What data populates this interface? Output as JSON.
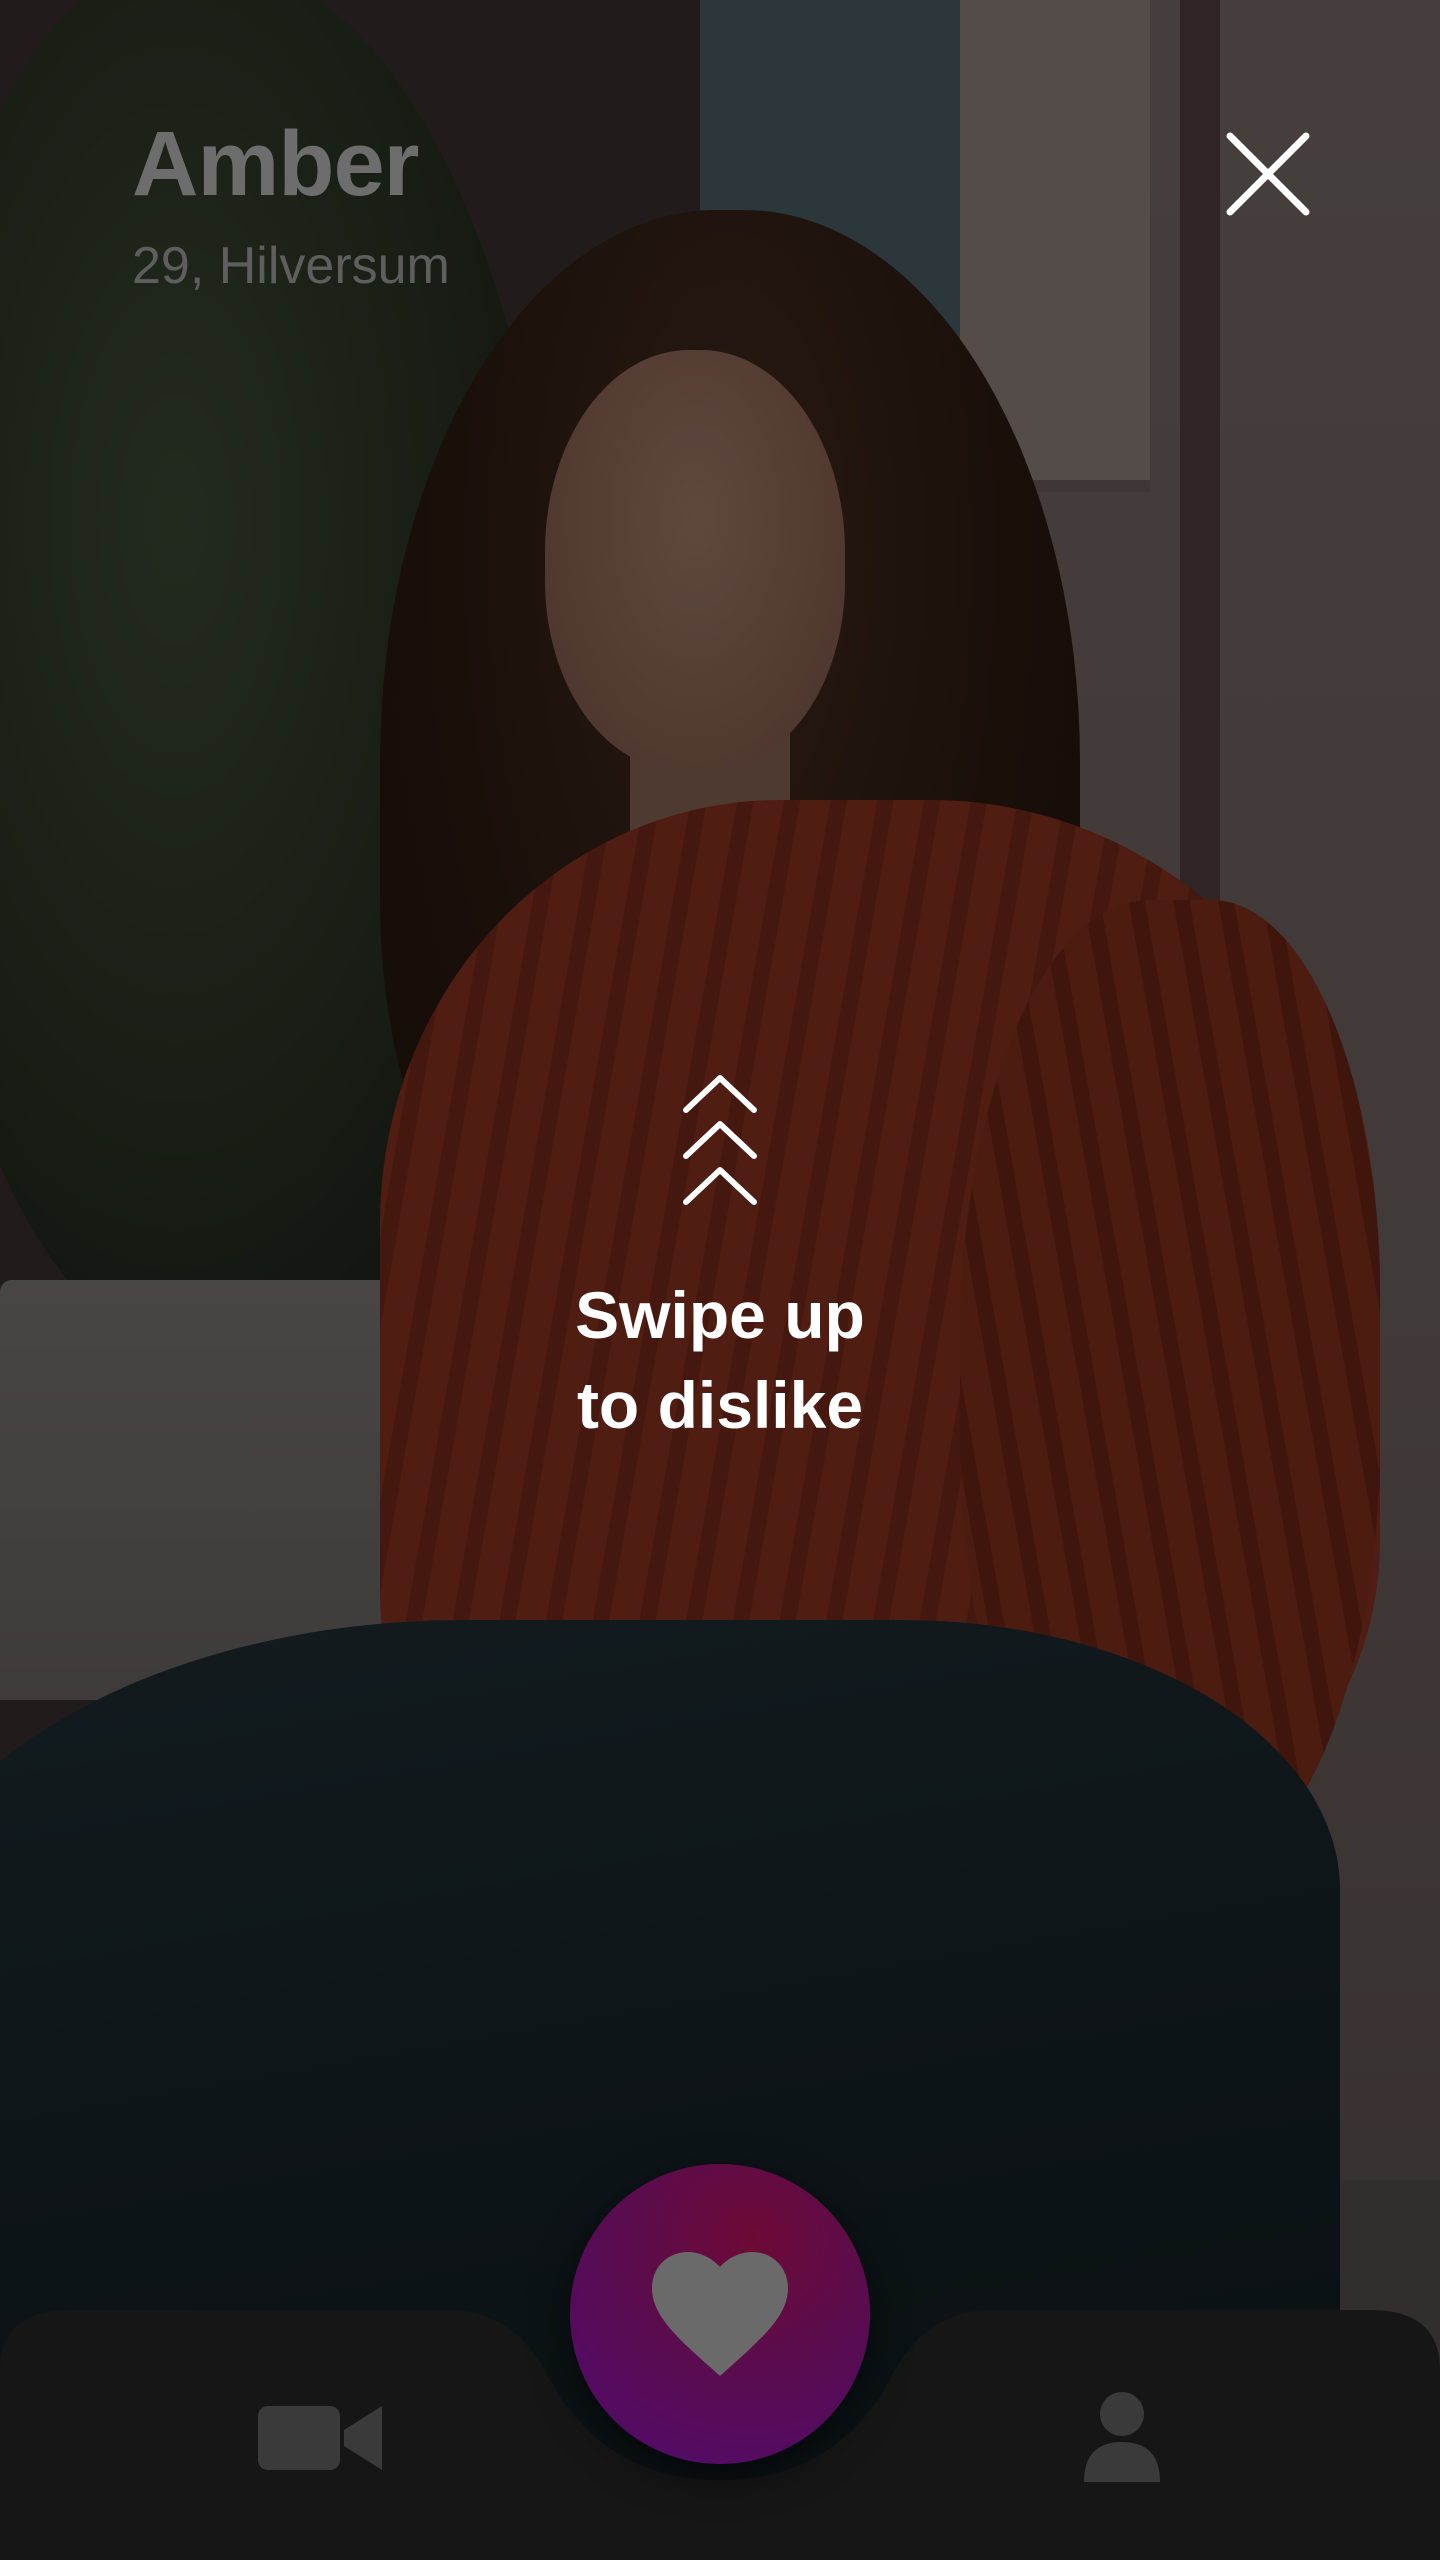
{
  "profile": {
    "name": "Amber",
    "meta": "29, Hilversum"
  },
  "hint": {
    "line1": "Swipe up",
    "line2": "to dislike"
  },
  "icons": {
    "close": "close-icon",
    "chevrons": "triple-chevron-up-icon",
    "like": "heart-icon",
    "video": "video-camera-icon",
    "profile": "person-icon"
  },
  "colors": {
    "background": "#0e0e0e",
    "nav_bar": "#161616",
    "nav_icon": "#3a3a3a",
    "like_gradient_top": "#6d0a36",
    "like_gradient_bottom": "#4f0a70",
    "heart": "#6a6a6a",
    "hint_text": "#ffffff"
  }
}
